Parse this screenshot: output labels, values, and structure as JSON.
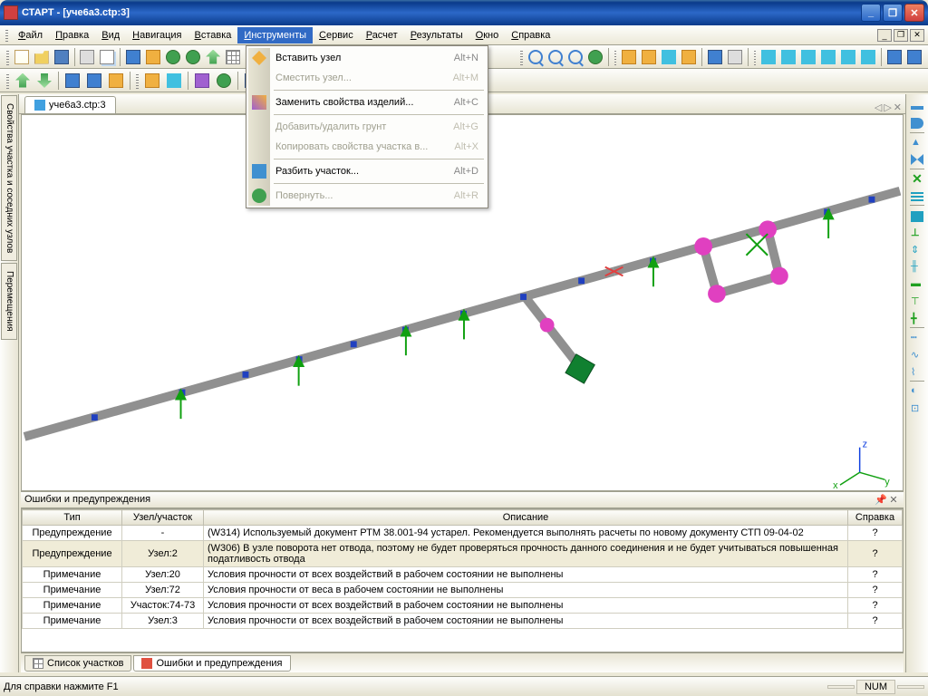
{
  "window": {
    "title": "СТАРТ - [уче6а3.ctp:3]"
  },
  "menu": {
    "items": [
      "Файл",
      "Правка",
      "Вид",
      "Навигация",
      "Вставка",
      "Инструменты",
      "Сервис",
      "Расчет",
      "Результаты",
      "Окно",
      "Справка"
    ],
    "open_index": 5
  },
  "dropdown": {
    "items": [
      {
        "label": "Вставить узел",
        "shortcut": "Alt+N",
        "enabled": true,
        "icon": "icp1"
      },
      {
        "label": "Сместить узел...",
        "shortcut": "Alt+M",
        "enabled": false
      },
      {
        "sep": true
      },
      {
        "label": "Заменить свойства изделий...",
        "shortcut": "Alt+C",
        "enabled": true,
        "icon": "icp3"
      },
      {
        "sep": true
      },
      {
        "label": "Добавить/удалить грунт",
        "shortcut": "Alt+G",
        "enabled": false
      },
      {
        "label": "Копировать свойства участка в...",
        "shortcut": "Alt+X",
        "enabled": false
      },
      {
        "sep": true
      },
      {
        "label": "Разбить участок...",
        "shortcut": "Alt+D",
        "enabled": true,
        "icon": "icp2"
      },
      {
        "sep": true
      },
      {
        "label": "Повернуть...",
        "shortcut": "Alt+R",
        "enabled": false,
        "icon": "icp4"
      }
    ]
  },
  "doc_tab": "уче6а3.ctp:3",
  "left_tabs": [
    "Свойства участка и соседних узлов",
    "Перемещения"
  ],
  "errors_panel": {
    "title": "Ошибки и предупреждения",
    "cols": [
      "Тип",
      "Узел/участок",
      "Описание",
      "Справка"
    ],
    "rows": [
      {
        "type": "Предупреждение",
        "node": "-",
        "desc": "(W314) Используемый документ РТМ 38.001-94 устарел. Рекомендуется выполнять расчеты по новому документу СТП 09-04-02",
        "help": "?",
        "sel": false
      },
      {
        "type": "Предупреждение",
        "node": "Узел:2",
        "desc": "(W306) В узле поворота нет отвода, поэтому не будет проверяться прочность данного соединения и не будет учитываться повышенная податливость отвода",
        "help": "?",
        "sel": true
      },
      {
        "type": "Примечание",
        "node": "Узел:20",
        "desc": "Условия прочности от всех воздействий в рабочем состоянии не выполнены",
        "help": "?",
        "sel": false
      },
      {
        "type": "Примечание",
        "node": "Узел:72",
        "desc": "Условия прочности от веса в рабочем состоянии не выполнены",
        "help": "?",
        "sel": false
      },
      {
        "type": "Примечание",
        "node": "Участок:74-73",
        "desc": "Условия прочности от всех воздействий в рабочем состоянии не выполнены",
        "help": "?",
        "sel": false
      },
      {
        "type": "Примечание",
        "node": "Узел:3",
        "desc": "Условия прочности от всех воздействий в рабочем состоянии не выполнены",
        "help": "?",
        "sel": false
      }
    ]
  },
  "bottom_tabs": [
    {
      "label": "Список участков",
      "icon": "ic-grid"
    },
    {
      "label": "Ошибки и предупреждения",
      "icon": "ic-red",
      "active": true
    }
  ],
  "status": {
    "hint": "Для справки нажмите F1",
    "num": "NUM"
  },
  "axis": {
    "x": "x",
    "y": "y",
    "z": "z"
  }
}
